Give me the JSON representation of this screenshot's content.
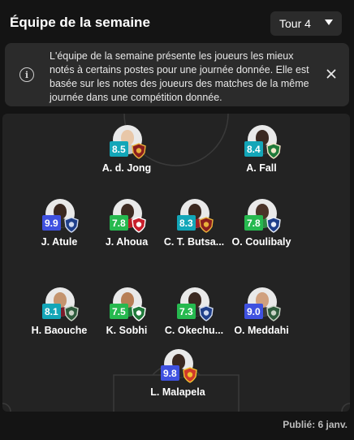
{
  "header": {
    "title": "Équipe de la semaine",
    "round_label": "Tour 4"
  },
  "info": {
    "text": "L'équipe de la semaine présente les joueurs les mieux notés à certains postes pour une journée donnée. Elle est basée sur les notes des joueurs des matches de la même journée dans une compétition donnée."
  },
  "colors": {
    "rating_teal": "#13a6b8",
    "rating_green": "#26b94f",
    "rating_blue": "#3f51e0",
    "background": "#141414",
    "pitch": "#232323"
  },
  "players": [
    {
      "name": "A. d. Jong",
      "rating": "8.5",
      "rating_color": "#13a6b8",
      "skin": "#e8c7a8",
      "shirt": "#c8c8c8",
      "crest_colors": [
        "#8b1e1e",
        "#e9b13a"
      ]
    },
    {
      "name": "A. Fall",
      "rating": "8.4",
      "rating_color": "#13a6b8",
      "skin": "#3b2a22",
      "shirt": "#2f2f2f",
      "crest_colors": [
        "#1f7a3a",
        "#f2e6c8"
      ]
    },
    {
      "name": "J. Atule",
      "rating": "9.9",
      "rating_color": "#3f51e0",
      "skin": "#3a2820",
      "shirt": "#2a2a2a",
      "crest_colors": [
        "#1f3f8a",
        "#cfd9ef"
      ]
    },
    {
      "name": "J. Ahoua",
      "rating": "7.8",
      "rating_color": "#26b94f",
      "skin": "#3e2b22",
      "shirt": "#b81d24",
      "crest_colors": [
        "#c81e2b",
        "#ffffff"
      ]
    },
    {
      "name": "C. T. Butsa...",
      "rating": "8.3",
      "rating_color": "#13a6b8",
      "skin": "#3a2820",
      "shirt": "#9e1f26",
      "crest_colors": [
        "#8b1e1e",
        "#e9b13a"
      ]
    },
    {
      "name": "O. Coulibaly",
      "rating": "7.8",
      "rating_color": "#26b94f",
      "skin": "#4a3328",
      "shirt": "#2f8a43",
      "crest_colors": [
        "#1f3f8a",
        "#e9eef9"
      ]
    },
    {
      "name": "H. Baouche",
      "rating": "8.1",
      "rating_color": "#13a6b8",
      "skin": "#c4946e",
      "shirt": "#7a1a2a",
      "crest_colors": [
        "#2e5b3c",
        "#c9d3c6"
      ]
    },
    {
      "name": "K. Sobhi",
      "rating": "7.5",
      "rating_color": "#26b94f",
      "skin": "#b77e55",
      "shirt": "#1f7a3a",
      "crest_colors": [
        "#1f7a3a",
        "#ffffff"
      ]
    },
    {
      "name": "C. Okechu...",
      "rating": "7.3",
      "rating_color": "#26b94f",
      "skin": "#3a2820",
      "shirt": "#2a2a2a",
      "crest_colors": [
        "#1f3f8a",
        "#cfd9ef"
      ]
    },
    {
      "name": "O. Meddahi",
      "rating": "9.0",
      "rating_color": "#3f51e0",
      "skin": "#d0a07e",
      "shirt": "#3a3a3a",
      "crest_colors": [
        "#2e5b3c",
        "#c9d3c6"
      ]
    },
    {
      "name": "L. Malapela",
      "rating": "9.8",
      "rating_color": "#3f51e0",
      "skin": "#3a2820",
      "shirt": "#2a2a2a",
      "crest_colors": [
        "#d03a2a",
        "#f2c230"
      ]
    }
  ],
  "footer": {
    "published": "Publié: 6 janv."
  }
}
